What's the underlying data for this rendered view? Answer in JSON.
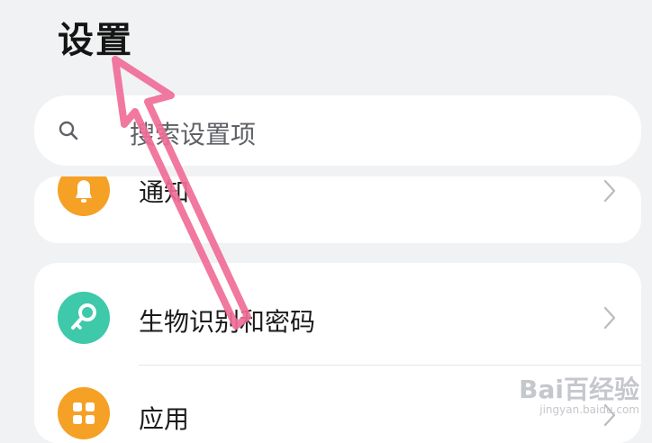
{
  "header": {
    "title": "设置"
  },
  "search": {
    "placeholder": "搜索设置项"
  },
  "list": {
    "notifications_label": "通知",
    "biometrics_label": "生物识别和密码",
    "apps_label": "应用"
  },
  "watermark": {
    "brand": "Bai百经验",
    "url": "jingyan.baidu.com"
  },
  "colors": {
    "background": "#f1f2f4",
    "notification_icon": "#f5a126",
    "biometrics_icon": "#3dc9aa",
    "apps_icon": "#f5a126",
    "annotation_arrow": "#f06d97"
  },
  "icons": {
    "search": "search-icon",
    "notification": "bell-icon",
    "biometrics": "key-icon",
    "apps": "apps-grid-icon",
    "chevron": "chevron-right-icon"
  }
}
